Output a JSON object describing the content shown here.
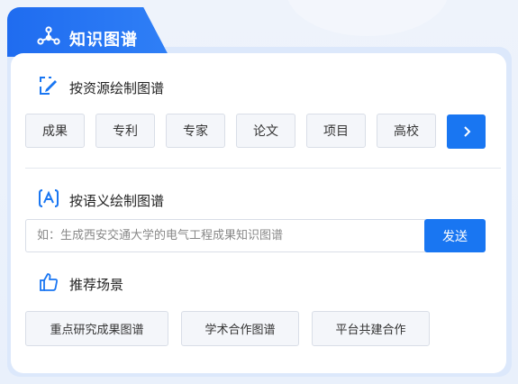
{
  "header": {
    "title": "知识图谱",
    "icon": "knowledge-graph-icon"
  },
  "resource_section": {
    "title": "按资源绘制图谱",
    "icon": "edit-box-icon",
    "buttons": [
      "成果",
      "专利",
      "专家",
      "论文",
      "项目",
      "高校"
    ],
    "next_icon": "chevron-right-icon"
  },
  "semantic_section": {
    "title": "按语义绘制图谱",
    "icon": "text-a-icon",
    "input_placeholder": "如：生成西安交通大学的电气工程成果知识图谱",
    "send_label": "发送"
  },
  "scene_section": {
    "title": "推荐场景",
    "icon": "thumbs-up-icon",
    "buttons": [
      "重点研究成果图谱",
      "学术合作图谱",
      "平台共建合作"
    ]
  },
  "colors": {
    "primary": "#1976f2",
    "tab_gradient_start": "#1f6cf0"
  }
}
